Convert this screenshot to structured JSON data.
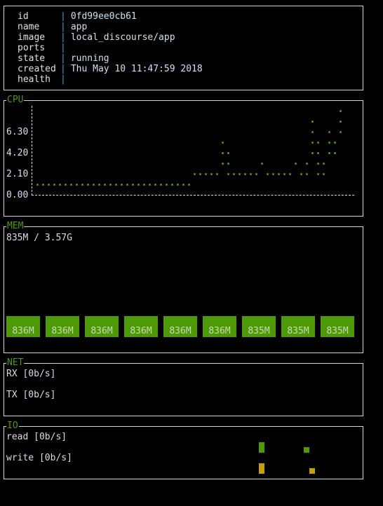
{
  "info": [
    {
      "key": "id",
      "value": "0fd99ee0cb61"
    },
    {
      "key": "name",
      "value": "app"
    },
    {
      "key": "image",
      "value": "local_discourse/app"
    },
    {
      "key": "ports",
      "value": ""
    },
    {
      "key": "state",
      "value": "running"
    },
    {
      "key": "created",
      "value": "Thu May 10 11:47:59 2018"
    },
    {
      "key": "health",
      "value": ""
    }
  ],
  "cpu": {
    "title": "CPU",
    "ticks": [
      "6.30",
      "4.20",
      "2.10",
      "0.00"
    ],
    "color": "#4e9a06"
  },
  "chart_data": {
    "type": "scatter",
    "title": "CPU",
    "yticks": [
      0.0,
      2.1,
      4.2,
      6.3
    ],
    "ylim": [
      0,
      8.4
    ],
    "columns": [
      [
        1.05
      ],
      [
        1.05
      ],
      [
        1.05
      ],
      [
        1.05
      ],
      [
        1.05
      ],
      [
        1.05
      ],
      [
        1.05
      ],
      [
        1.05
      ],
      [
        1.05
      ],
      [
        1.05
      ],
      [
        1.05
      ],
      [
        1.05
      ],
      [
        1.05
      ],
      [
        1.05
      ],
      [
        1.05
      ],
      [
        1.05
      ],
      [
        1.05
      ],
      [
        1.05
      ],
      [
        1.05
      ],
      [
        1.05
      ],
      [
        1.05
      ],
      [
        1.05
      ],
      [
        1.05
      ],
      [
        1.05
      ],
      [
        1.05
      ],
      [
        1.05
      ],
      [
        1.05
      ],
      [
        1.05
      ],
      [
        2.1
      ],
      [
        2.1
      ],
      [
        2.1
      ],
      [
        2.1
      ],
      [
        2.1
      ],
      [
        3.15,
        4.2,
        5.25
      ],
      [
        2.1,
        3.15,
        4.2
      ],
      [
        2.1
      ],
      [
        2.1
      ],
      [
        2.1
      ],
      [
        2.1
      ],
      [
        2.1
      ],
      [
        3.15
      ],
      [
        2.1
      ],
      [
        2.1
      ],
      [
        2.1
      ],
      [
        2.1
      ],
      [
        2.1
      ],
      [
        3.15
      ],
      [
        2.1
      ],
      [
        2.1,
        3.15
      ],
      [
        4.2,
        5.25,
        6.3,
        7.35
      ],
      [
        2.1,
        3.15,
        4.2,
        5.25
      ],
      [
        2.1,
        3.15
      ],
      [
        4.2,
        5.25,
        6.3
      ],
      [
        4.2,
        5.25
      ],
      [
        6.3,
        7.35,
        8.4
      ]
    ]
  },
  "mem": {
    "title": "MEM",
    "summary": "835M / 3.57G",
    "bars": [
      "836M",
      "836M",
      "836M",
      "836M",
      "836M",
      "836M",
      "835M",
      "835M",
      "835M"
    ],
    "color": "#4e9a06"
  },
  "net": {
    "title": "NET",
    "rx": "RX [0b/s]",
    "tx": "TX [0b/s]"
  },
  "io": {
    "title": "IO",
    "read": "read [0b/s]",
    "write": "write [0b/s]",
    "read_color": "#4e9a06",
    "write_color": "#c4a000"
  }
}
